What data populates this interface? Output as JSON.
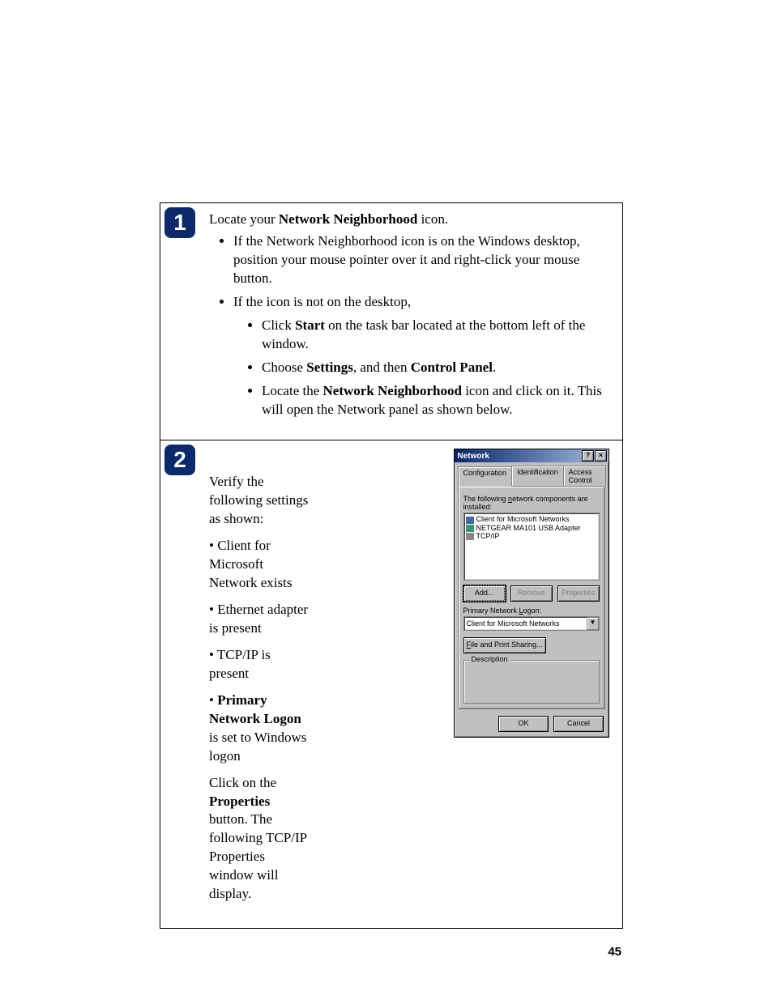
{
  "page_number": "45",
  "step1": {
    "badge": "1",
    "intro_pre": "Locate your ",
    "intro_bold": "Network Neighborhood",
    "intro_post": " icon.",
    "b1": "If the Network Neighborhood icon is on the Windows desktop, position your mouse pointer over it and right-click your mouse button.",
    "b2": "If the icon is not on the desktop,",
    "s1_pre": "Click ",
    "s1_bold": "Start",
    "s1_post": " on the task bar located at the bottom left of the window.",
    "s2_pre": "Choose ",
    "s2_bold1": "Settings",
    "s2_mid": ", and then ",
    "s2_bold2": "Control Panel",
    "s2_post": ".",
    "s3_pre": "Locate the ",
    "s3_bold": "Network Neighborhood",
    "s3_post": " icon and click on it. This will open the Network panel as shown below."
  },
  "step2": {
    "badge": "2",
    "p1": "Verify the following settings as shown:",
    "c1": "• Client for Microsoft Network exists",
    "c2": "• Ethernet adapter is present",
    "c3": "• TCP/IP is present",
    "c4_pre": "• ",
    "c4_bold": "Primary Network Logon",
    "c4_post": " is set to Windows logon",
    "p2_pre": "Click on the ",
    "p2_bold": "Properties",
    "p2_post": " button. The following TCP/IP Properties window will display."
  },
  "dialog": {
    "title": "Network",
    "help": "?",
    "close": "×",
    "tabs": {
      "t1": "Configuration",
      "t2": "Identification",
      "t3": "Access Control"
    },
    "list_label": "The following network components are installed:",
    "items": {
      "i1": "Client for Microsoft Networks",
      "i2": "NETGEAR MA101 USB Adapter",
      "i3": "TCP/IP"
    },
    "add": "Add...",
    "remove": "Remove",
    "properties": "Properties",
    "logon_label": "Primary Network Logon:",
    "logon_value": "Client for Microsoft Networks",
    "fps": "File and Print Sharing...",
    "desc": "Description",
    "ok": "OK",
    "cancel": "Cancel"
  }
}
